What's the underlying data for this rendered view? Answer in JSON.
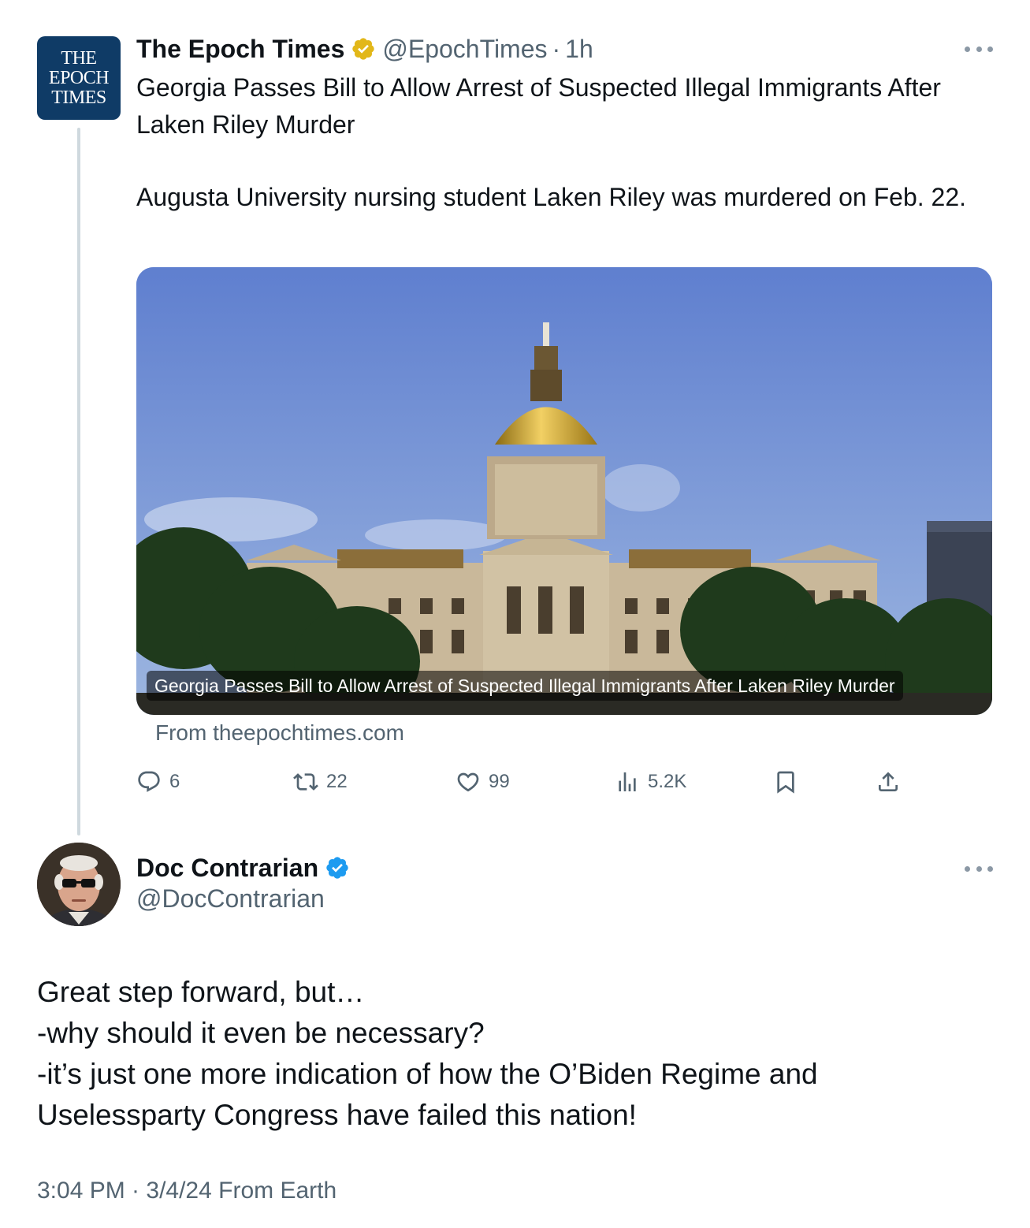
{
  "quoted_tweet": {
    "avatar_lines": [
      "THE",
      "EPOCH",
      "TIMES"
    ],
    "display_name": "The Epoch Times",
    "verification": "gold-check-icon",
    "handle": "@EpochTimes",
    "separator": "·",
    "time": "1h",
    "text_lines": [
      "Georgia Passes Bill to Allow Arrest of Suspected Illegal Immigrants After Laken Riley Murder",
      "Augusta University nursing student Laken Riley was murdered on Feb. 22."
    ],
    "link_card": {
      "caption": "Georgia Passes Bill to Allow Arrest of Suspected Illegal Immigrants After Laken Riley Murder",
      "source": "From theepochtimes.com"
    },
    "actions": {
      "replies": "6",
      "reposts": "22",
      "likes": "99",
      "views": "5.2K"
    }
  },
  "reply_tweet": {
    "display_name": "Doc Contrarian",
    "verification": "blue-check-icon",
    "handle": "@DocContrarian",
    "text_lines": [
      "Great step forward, but…",
      "-why should it even be necessary?",
      "-it’s just one more indication of how the O’Biden Regime and",
      "Uselessparty Congress have failed this nation!"
    ],
    "timestamp": "3:04 PM · 3/4/24 From Earth"
  },
  "colors": {
    "text_primary": "#0f1419",
    "text_secondary": "#536471",
    "epoch_blue": "#0f3b66",
    "verified_gold": "#e2b719",
    "verified_blue": "#1d9bf0",
    "thread_line": "#cfd9de"
  }
}
